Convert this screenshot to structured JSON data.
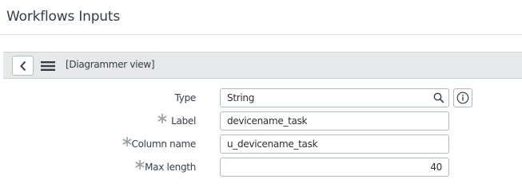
{
  "page": {
    "title": "Workflows Inputs"
  },
  "toolbar": {
    "back_icon": "chevron-left-icon",
    "menu_icon": "hamburger-menu-icon",
    "view_label": "[Diagrammer view]"
  },
  "form": {
    "required_color": "#9aa0a6",
    "fields": [
      {
        "label": "Type",
        "value": "String",
        "required": false,
        "icons": [
          "search-icon",
          "info-icon"
        ]
      },
      {
        "label": "Label",
        "value": "devicename_task",
        "required": true
      },
      {
        "label": "Column name",
        "value": "u_devicename_task",
        "required": true
      },
      {
        "label": "Max length",
        "value": "40",
        "required": true,
        "align": "right"
      }
    ]
  }
}
